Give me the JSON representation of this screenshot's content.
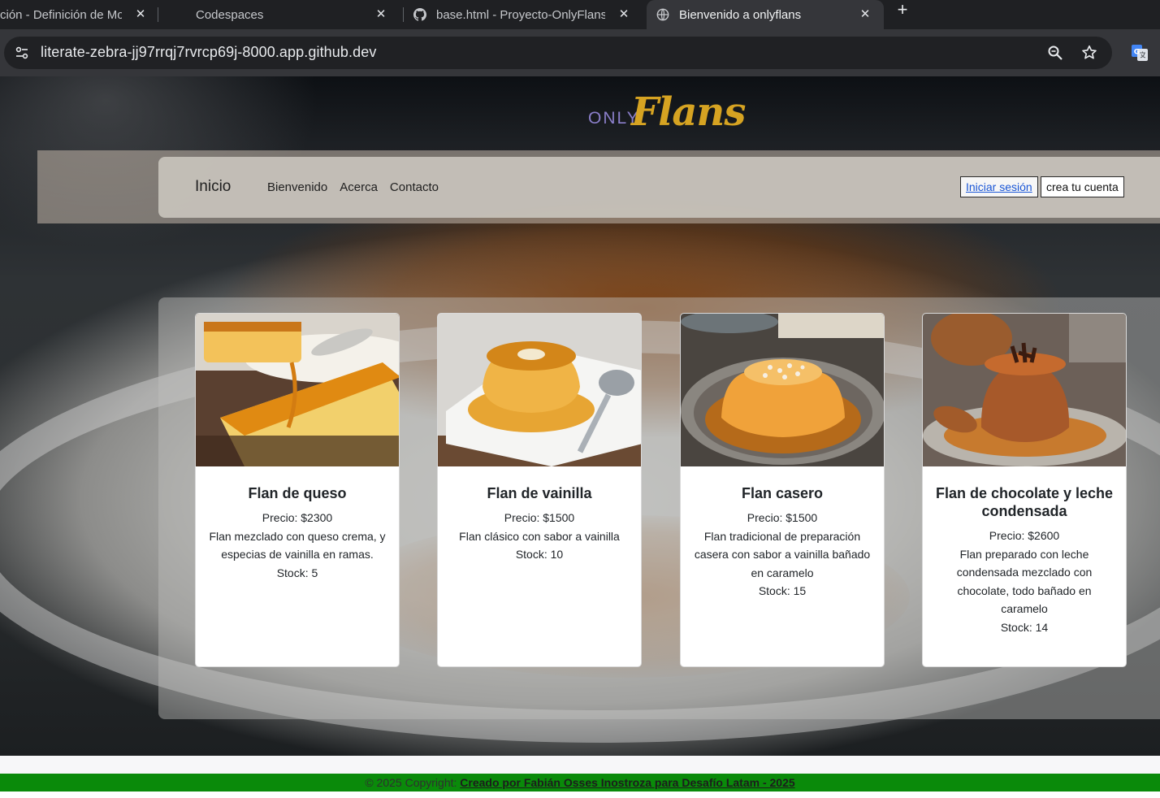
{
  "browser": {
    "tabs": [
      {
        "title": "ción - Definición de Mo",
        "active": false
      },
      {
        "title": "Codespaces",
        "active": false
      },
      {
        "title": "base.html - Proyecto-OnlyFlans",
        "active": false
      },
      {
        "title": "Bienvenido a onlyflans",
        "active": true
      }
    ],
    "close_glyph": "✕",
    "new_tab_glyph": "+",
    "url": "literate-zebra-jj97rrqj7rvrcp69j-8000.app.github.dev"
  },
  "site": {
    "logo": {
      "only": "ONLY",
      "flans": "Flans"
    },
    "nav": {
      "brand": "Inicio",
      "links": [
        "Bienvenido",
        "Acerca",
        "Contacto"
      ],
      "login": "Iniciar sesión",
      "signup": "crea tu cuenta"
    },
    "products": [
      {
        "name": "Flan de queso",
        "price": "Precio: $2300",
        "description": "Flan mezclado con queso crema, y especias de vainilla en ramas.",
        "stock": "Stock: 5"
      },
      {
        "name": "Flan de vainilla",
        "price": "Precio: $1500",
        "description": "Flan clásico con sabor a vainilla",
        "stock": "Stock: 10"
      },
      {
        "name": "Flan casero",
        "price": "Precio: $1500",
        "description": "Flan tradicional de preparación casera con sabor a vainilla bañado en caramelo",
        "stock": "Stock: 15"
      },
      {
        "name": "Flan de chocolate y leche condensada",
        "price": "Precio: $2600",
        "description": "Flan preparado con leche condensada mezclado con chocolate, todo bañado en caramelo",
        "stock": "Stock: 14"
      }
    ],
    "footer": {
      "prefix": "© 2025 Copyright:",
      "link": "Creado por Fabián Osses Inostroza para Desafío Latam - 2025"
    }
  },
  "colors": {
    "accent_flans": "#d6a322",
    "accent_only": "#8a7ec9",
    "footer_green": "#0a8a0a",
    "chrome_dark": "#1f2023"
  }
}
